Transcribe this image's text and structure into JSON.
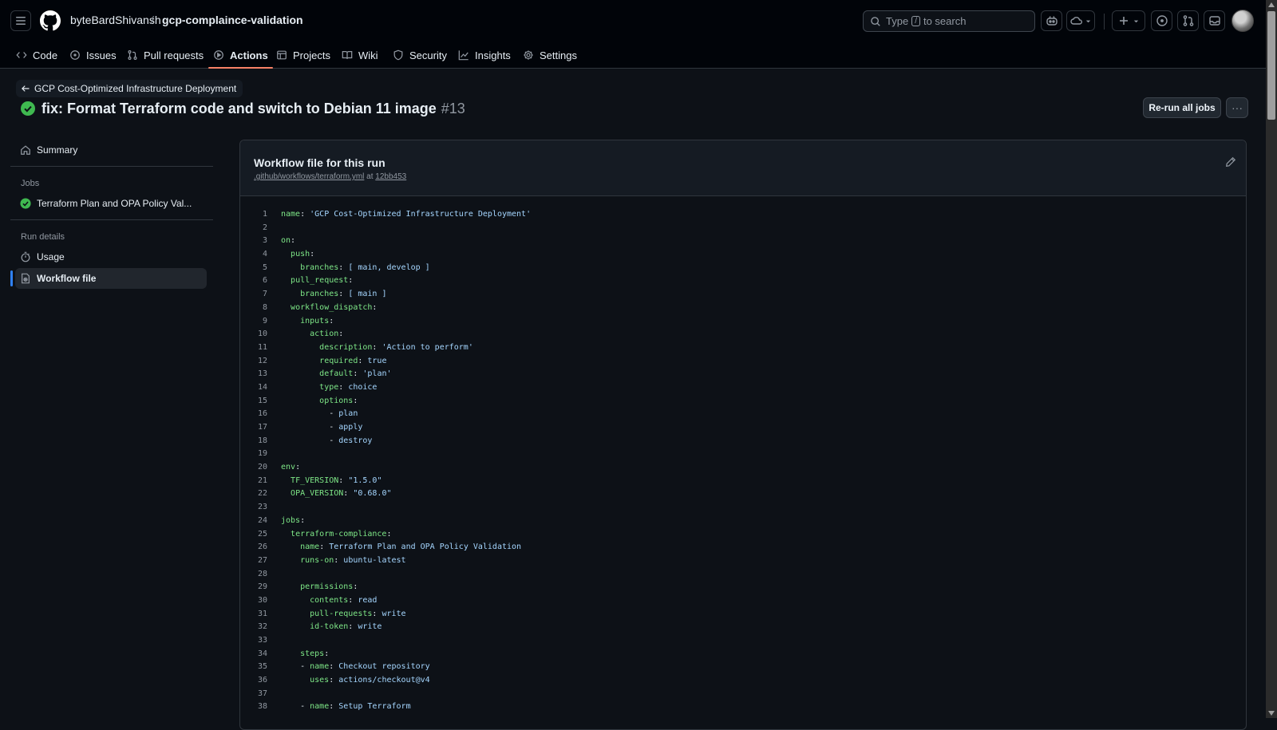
{
  "header": {
    "owner": "byteBardShivansh",
    "separator": "/",
    "repo": "gcp-complaince-validation",
    "search": {
      "prefix": "Type",
      "key": "/",
      "suffix": "to search"
    }
  },
  "tabs": [
    {
      "label": "Code",
      "icon": "code-icon"
    },
    {
      "label": "Issues",
      "icon": "issue-icon"
    },
    {
      "label": "Pull requests",
      "icon": "pull-request-icon"
    },
    {
      "label": "Actions",
      "icon": "play-icon",
      "active": true
    },
    {
      "label": "Projects",
      "icon": "table-icon"
    },
    {
      "label": "Wiki",
      "icon": "book-icon"
    },
    {
      "label": "Security",
      "icon": "shield-icon"
    },
    {
      "label": "Insights",
      "icon": "graph-icon"
    },
    {
      "label": "Settings",
      "icon": "gear-icon"
    }
  ],
  "run": {
    "back_label": "GCP Cost-Optimized Infrastructure Deployment",
    "title": "fix: Format Terraform code and switch to Debian 11 image",
    "number": "#13",
    "status_color": "#3fb950",
    "rerun_label": "Re-run all jobs",
    "more_label": "···"
  },
  "sidebar": {
    "summary": "Summary",
    "jobs_heading": "Jobs",
    "job": "Terraform Plan and OPA Policy Val...",
    "details_heading": "Run details",
    "usage": "Usage",
    "workflow_file": "Workflow file"
  },
  "panel": {
    "title": "Workflow file for this run",
    "path": ".github/workflows/terraform.yml",
    "at": "at",
    "commit": "12bb453"
  },
  "code_lines": [
    "name: 'GCP Cost-Optimized Infrastructure Deployment'",
    "",
    "on:",
    "  push:",
    "    branches: [ main, develop ]",
    "  pull_request:",
    "    branches: [ main ]",
    "  workflow_dispatch:",
    "    inputs:",
    "      action:",
    "        description: 'Action to perform'",
    "        required: true",
    "        default: 'plan'",
    "        type: choice",
    "        options:",
    "          - plan",
    "          - apply",
    "          - destroy",
    "",
    "env:",
    "  TF_VERSION: \"1.5.0\"",
    "  OPA_VERSION: \"0.68.0\"",
    "",
    "jobs:",
    "  terraform-compliance:",
    "    name: Terraform Plan and OPA Policy Validation",
    "    runs-on: ubuntu-latest",
    "",
    "    permissions:",
    "      contents: read",
    "      pull-requests: write",
    "      id-token: write",
    "",
    "    steps:",
    "    - name: Checkout repository",
    "      uses: actions/checkout@v4",
    "",
    "    - name: Setup Terraform"
  ]
}
